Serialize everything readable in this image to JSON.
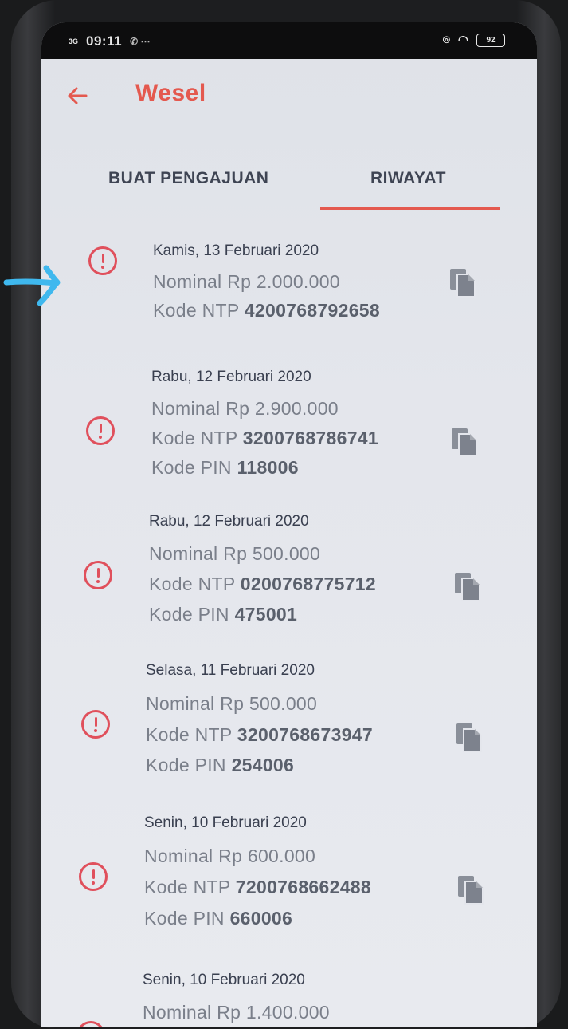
{
  "status_bar": {
    "signal": "3G",
    "time": "09:11",
    "battery": "92"
  },
  "app_bar": {
    "title": "Wesel"
  },
  "tabs": [
    {
      "label": "BUAT PENGAJUAN",
      "selected": false
    },
    {
      "label": "RIWAYAT",
      "selected": true
    }
  ],
  "history": [
    {
      "date": "Kamis, 13 Februari 2020",
      "nominal_label": "Nominal Rp",
      "nominal": "2.000.000",
      "ntp_label": "Kode NTP",
      "ntp": "4200768792658"
    },
    {
      "date": "Rabu, 12 Februari 2020",
      "nominal_label": "Nominal Rp",
      "nominal": "2.900.000",
      "ntp_label": "Kode NTP",
      "ntp": "3200768786741",
      "pin_label": "Kode PIN",
      "pin": "118006"
    },
    {
      "date": "Rabu, 12 Februari 2020",
      "nominal_label": "Nominal Rp",
      "nominal": "500.000",
      "ntp_label": "Kode NTP",
      "ntp": "0200768775712",
      "pin_label": "Kode PIN",
      "pin": "475001"
    },
    {
      "date": "Selasa, 11 Februari 2020",
      "nominal_label": "Nominal Rp",
      "nominal": "500.000",
      "ntp_label": "Kode NTP",
      "ntp": "3200768673947",
      "pin_label": "Kode PIN",
      "pin": "254006"
    },
    {
      "date": "Senin, 10 Februari 2020",
      "nominal_label": "Nominal Rp",
      "nominal": "600.000",
      "ntp_label": "Kode NTP",
      "ntp": "7200768662488",
      "pin_label": "Kode PIN",
      "pin": "660006"
    },
    {
      "date": "Senin, 10 Februari 2020",
      "nominal_label": "Nominal Rp",
      "nominal": "1.400.000"
    }
  ],
  "icons": {
    "back": "arrow-left-icon",
    "status": "alert-circle-icon",
    "copy": "copy-icon",
    "annotation": "arrow-right-icon"
  },
  "colors": {
    "accent": "#e4594f",
    "alert": "#e0505c",
    "annotation_arrow": "#3fb8ee"
  }
}
